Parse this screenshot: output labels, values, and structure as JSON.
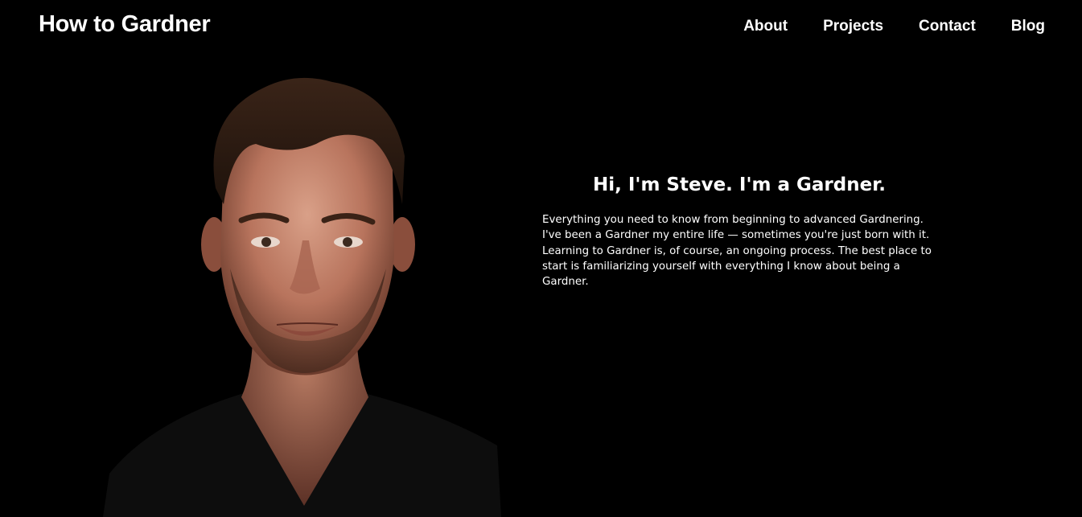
{
  "header": {
    "site_title": "How to Gardner",
    "nav": [
      {
        "label": "About"
      },
      {
        "label": "Projects"
      },
      {
        "label": "Contact"
      },
      {
        "label": "Blog"
      }
    ]
  },
  "hero": {
    "portrait_description_icon": "portrait-photo",
    "heading": "Hi, I'm Steve. I'm a Gardner.",
    "body": "Everything you need to know from beginning to advanced Gardnering. I've been a Gardner my entire life — sometimes you're just born with it. Learning to Gardner is, of course, an ongoing process. The best place to start is familiarizing yourself with everything I know about being a Gardner."
  },
  "colors": {
    "background": "#000000",
    "text": "#ffffff"
  }
}
